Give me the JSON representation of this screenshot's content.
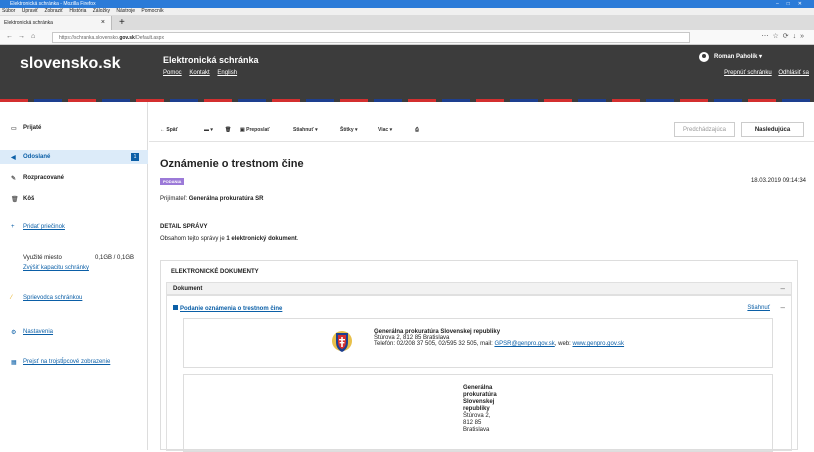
{
  "browser": {
    "window_title": "Elektronická schránka - Mozilla Firefox",
    "menu": [
      "Súbor",
      "Upraviť",
      "Zobraziť",
      "História",
      "Záložky",
      "Nástroje",
      "Pomocník"
    ],
    "tab_title": "Elektronická schránka",
    "url_host": "https://schranka.slovensko.",
    "url_domain": "gov.sk",
    "url_path": "/Default.aspx"
  },
  "header": {
    "logo": "slovensko.sk",
    "app_title": "Elektronická schránka",
    "links": [
      "Pomoc",
      "Kontakt",
      "English"
    ],
    "user_name": "Roman Paholík",
    "switch_box": "Prepnúť schránku",
    "logout": "Odhlásiť sa"
  },
  "sidebar": {
    "items": [
      {
        "label": "Prijaté",
        "icon": "inbox-icon"
      },
      {
        "label": "Odoslané",
        "icon": "send-icon",
        "badge": "1"
      },
      {
        "label": "Rozpracované",
        "icon": "pencil-icon"
      },
      {
        "label": "Kôš",
        "icon": "trash-icon"
      }
    ],
    "add_folder": "Pridať priečinok",
    "usage_label": "Využité miesto",
    "usage_value": "0,1GB / 0,1GB",
    "increase_capacity": "Zvýšiť kapacitu schránky",
    "guide": "Sprievodca schránkou",
    "settings": "Nastavenia",
    "three_column": "Prejsť na trojstĺpcové zobrazenie"
  },
  "toolbar": {
    "back": "Späť",
    "forward": "Preposlať",
    "download": "Stiahnuť",
    "tags": "Štítky",
    "more": "Viac",
    "previous": "Predchádzajúca",
    "next": "Nasledujúca"
  },
  "message": {
    "title": "Oznámenie o trestnom čine",
    "tag": "PODANIA",
    "date": "18.03.2019 09:14:34",
    "recipient_label": "Prijímateľ:",
    "recipient": "Generálna prokuratúra SR",
    "detail_heading": "DETAIL SPRÁVY",
    "detail_text_prefix": "Obsahom tejto správy je ",
    "detail_text_bold": "1 elektronický dokument",
    "detail_text_suffix": "."
  },
  "documents": {
    "heading": "ELEKTRONICKÉ DOKUMENTY",
    "column": "Dokument",
    "doc_name": "Podanie oznámenia o trestnom čine",
    "download": "Stiahnuť",
    "org_name": "Generálna prokuratúra Slovenskej republiky",
    "org_address": "Štúrova 2, 812 85 Bratislava",
    "org_contact_prefix": "Telefón: 02/208 37 505, 02/595 32 505, mail: ",
    "org_email": "GPSR@genpro.gov.sk",
    "org_contact_mid": ", web: ",
    "org_web": "www.genpro.gov.sk",
    "org2_lines": [
      "Generálna",
      "prokuratúra",
      "Slovenskej",
      "republiky"
    ],
    "org2_address": [
      "Štúrova 2,",
      "812 85",
      "Bratislava"
    ]
  }
}
